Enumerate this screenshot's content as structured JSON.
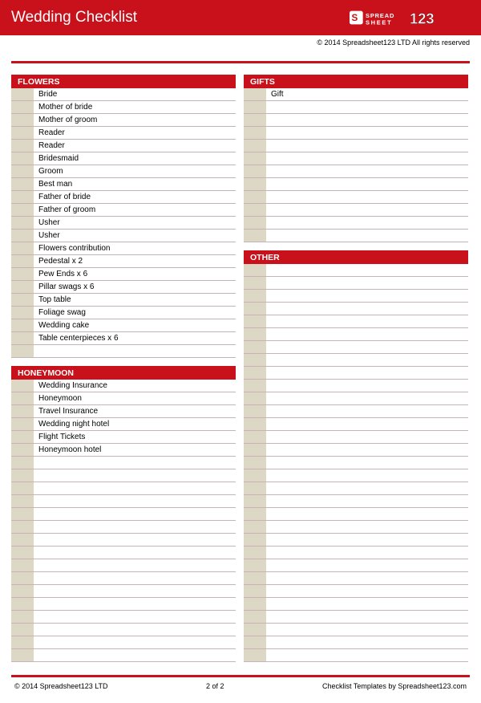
{
  "header": {
    "title": "Wedding Checklist",
    "copyright_top": "© 2014 Spreadsheet123 LTD All rights reserved"
  },
  "columns": {
    "left": [
      {
        "title": "FLOWERS",
        "rows_total": 21,
        "items": [
          "Bride",
          "Mother of bride",
          "Mother of groom",
          "Reader",
          "Reader",
          "Bridesmaid",
          "Groom",
          "Best man",
          "Father of bride",
          "Father of groom",
          "Usher",
          "Usher",
          "Flowers contribution",
          "Pedestal x 2",
          "Pew Ends x 6",
          "Pillar swags x 6",
          "Top table",
          "Foliage swag",
          "Wedding cake",
          "Table centerpieces x 6"
        ]
      },
      {
        "title": "HONEYMOON",
        "rows_total": 22,
        "items": [
          "Wedding Insurance",
          "Honeymoon",
          "Travel Insurance",
          "Wedding night hotel",
          "Flight Tickets",
          "Honeymoon hotel"
        ]
      }
    ],
    "right": [
      {
        "title": "GIFTS",
        "rows_total": 12,
        "items": [
          "Gift"
        ]
      },
      {
        "title": "OTHER",
        "rows_total": 31,
        "items": []
      }
    ]
  },
  "footer": {
    "left": "© 2014 Spreadsheet123 LTD",
    "center": "2 of 2",
    "right": "Checklist Templates by Spreadsheet123.com"
  }
}
